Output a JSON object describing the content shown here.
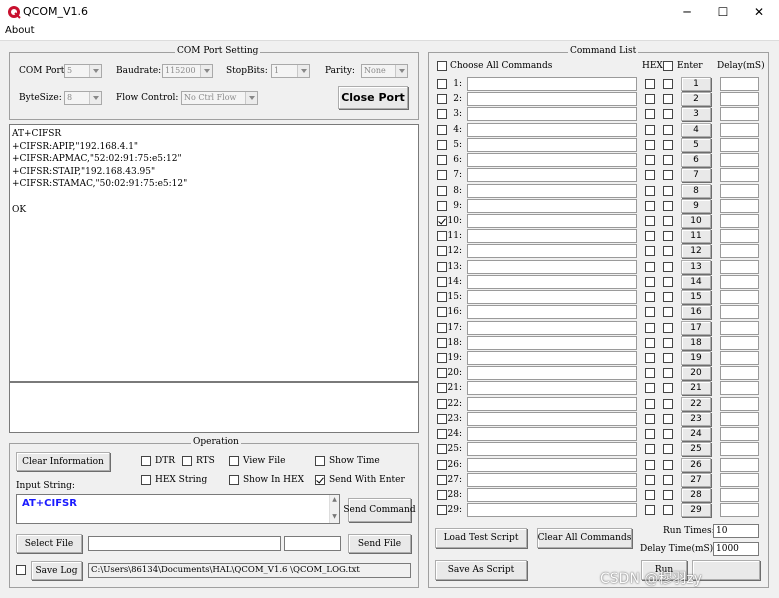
{
  "window": {
    "title": "QCOM_V1.6",
    "minimize_glyph": "─",
    "maximize_glyph": "☐",
    "close_glyph": "✕"
  },
  "menu": {
    "about": "About"
  },
  "com_setting": {
    "title": "COM Port Setting",
    "com_port_label": "COM Port:",
    "com_port_value": "5",
    "baudrate_label": "Baudrate:",
    "baudrate_value": "115200",
    "stopbits_label": "StopBits:",
    "stopbits_value": "1",
    "parity_label": "Parity:",
    "parity_value": "None",
    "bytesize_label": "ByteSize:",
    "bytesize_value": "8",
    "flow_label": "Flow Control:",
    "flow_value": "No Ctrl Flow",
    "close_port": "Close Port"
  },
  "receive": {
    "lines": [
      "AT+CIFSR",
      "+CIFSR:APIP,\"192.168.4.1\"",
      "+CIFSR:APMAC,\"52:02:91:75:e5:12\"",
      "+CIFSR:STAIP,\"192.168.43.95\"",
      "+CIFSR:STAMAC,\"50:02:91:75:e5:12\"",
      "",
      "OK"
    ]
  },
  "operation": {
    "title": "Operation",
    "clear_information": "Clear Information",
    "dtr": "DTR",
    "rts": "RTS",
    "view_file": "View File",
    "show_time": "Show Time",
    "hex_string": "HEX String",
    "show_in_hex": "Show In HEX",
    "send_with_enter": "Send With Enter",
    "input_string_label": "Input String:",
    "input_string_value": "AT+CIFSR",
    "send_command": "Send Command",
    "select_file": "Select File",
    "send_file": "Send File",
    "save_log": "Save Log",
    "log_path": "C:\\Users\\86134\\Documents\\HAL\\QCOM_V1.6 \\QCOM_LOG.txt"
  },
  "command_list": {
    "title": "Command List",
    "choose_all": "Choose All Commands",
    "hex_header": "HEX",
    "enter_header": "Enter",
    "delay_header": "Delay(mS)",
    "rows": [
      {
        "num": "1:",
        "btn": "1",
        "checked": false
      },
      {
        "num": "2:",
        "btn": "2",
        "checked": false
      },
      {
        "num": "3:",
        "btn": "3",
        "checked": false
      },
      {
        "num": "4:",
        "btn": "4",
        "checked": false
      },
      {
        "num": "5:",
        "btn": "5",
        "checked": false
      },
      {
        "num": "6:",
        "btn": "6",
        "checked": false
      },
      {
        "num": "7:",
        "btn": "7",
        "checked": false
      },
      {
        "num": "8:",
        "btn": "8",
        "checked": false
      },
      {
        "num": "9:",
        "btn": "9",
        "checked": false
      },
      {
        "num": "10:",
        "btn": "10",
        "checked": true
      },
      {
        "num": "11:",
        "btn": "11",
        "checked": false
      },
      {
        "num": "12:",
        "btn": "12",
        "checked": false
      },
      {
        "num": "13:",
        "btn": "13",
        "checked": false
      },
      {
        "num": "14:",
        "btn": "14",
        "checked": false
      },
      {
        "num": "15:",
        "btn": "15",
        "checked": false
      },
      {
        "num": "16:",
        "btn": "16",
        "checked": false
      },
      {
        "num": "17:",
        "btn": "17",
        "checked": false
      },
      {
        "num": "18:",
        "btn": "18",
        "checked": false
      },
      {
        "num": "19:",
        "btn": "19",
        "checked": false
      },
      {
        "num": "20:",
        "btn": "20",
        "checked": false
      },
      {
        "num": "21:",
        "btn": "21",
        "checked": false
      },
      {
        "num": "22:",
        "btn": "22",
        "checked": false
      },
      {
        "num": "23:",
        "btn": "23",
        "checked": false
      },
      {
        "num": "24:",
        "btn": "24",
        "checked": false
      },
      {
        "num": "25:",
        "btn": "25",
        "checked": false
      },
      {
        "num": "26:",
        "btn": "26",
        "checked": false
      },
      {
        "num": "27:",
        "btn": "27",
        "checked": false
      },
      {
        "num": "28:",
        "btn": "28",
        "checked": false
      },
      {
        "num": "29:",
        "btn": "29",
        "checked": false
      }
    ],
    "load_test_script": "Load Test Script",
    "clear_all_commands": "Clear All Commands",
    "run_times_label": "Run Times:",
    "run_times_value": "10",
    "delay_time_label": "Delay Time(mS):",
    "delay_time_value": "1000",
    "save_as_script": "Save As Script",
    "run": "Run"
  },
  "watermark": "CSDN @穆羽zy",
  "colors": {
    "input_text": "#1a1aff",
    "group_border": "#a0a0a0",
    "background": "#f0f0f0"
  }
}
